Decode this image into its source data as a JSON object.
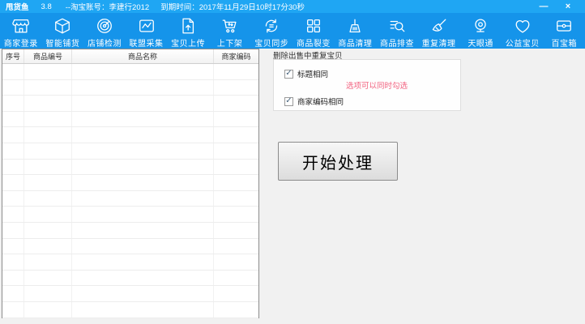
{
  "window": {
    "app_title": "甩货鱼",
    "version": "3.8",
    "account_info": "--淘宝账号：李建行2012",
    "expiry_info": "到期时间：2017年11月29日10时17分30秒",
    "minimize_glyph": "—",
    "close_glyph": "×"
  },
  "toolbar": {
    "items": [
      {
        "label": "商家登录",
        "icon": "storefront-icon"
      },
      {
        "label": "智能铺货",
        "icon": "box-icon"
      },
      {
        "label": "店铺检测",
        "icon": "radar-icon"
      },
      {
        "label": "联盟采集",
        "icon": "chart-box-icon"
      },
      {
        "label": "宝贝上传",
        "icon": "upload-doc-icon"
      },
      {
        "label": "上下架",
        "icon": "cart-icon"
      },
      {
        "label": "宝贝同步",
        "icon": "sync-icon"
      },
      {
        "label": "商品裂变",
        "icon": "grid-icon"
      },
      {
        "label": "商品清理",
        "icon": "broom-icon"
      },
      {
        "label": "商品排查",
        "icon": "search-list-icon"
      },
      {
        "label": "重复清理",
        "icon": "brush-icon"
      },
      {
        "label": "天眼通",
        "icon": "webcam-icon"
      },
      {
        "label": "公益宝贝",
        "icon": "heart-icon"
      },
      {
        "label": "百宝箱",
        "icon": "chest-icon"
      }
    ]
  },
  "table": {
    "columns": [
      "序号",
      "商品编号",
      "商品名称",
      "商家编码"
    ],
    "rows": []
  },
  "panel": {
    "group_label": "删除出售中重复宝贝",
    "checkboxes": [
      {
        "label": "标题相同",
        "checked": true
      },
      {
        "label": "商家编码相同",
        "checked": true
      }
    ],
    "hint": "选项可以同时勾选"
  },
  "actions": {
    "start_button_label": "开始处理"
  },
  "colors": {
    "titlebar": "#1fa6f3",
    "toolbar": "#1594ea",
    "hint_text": "#f2617f",
    "window_bg": "#f1f1f1"
  }
}
